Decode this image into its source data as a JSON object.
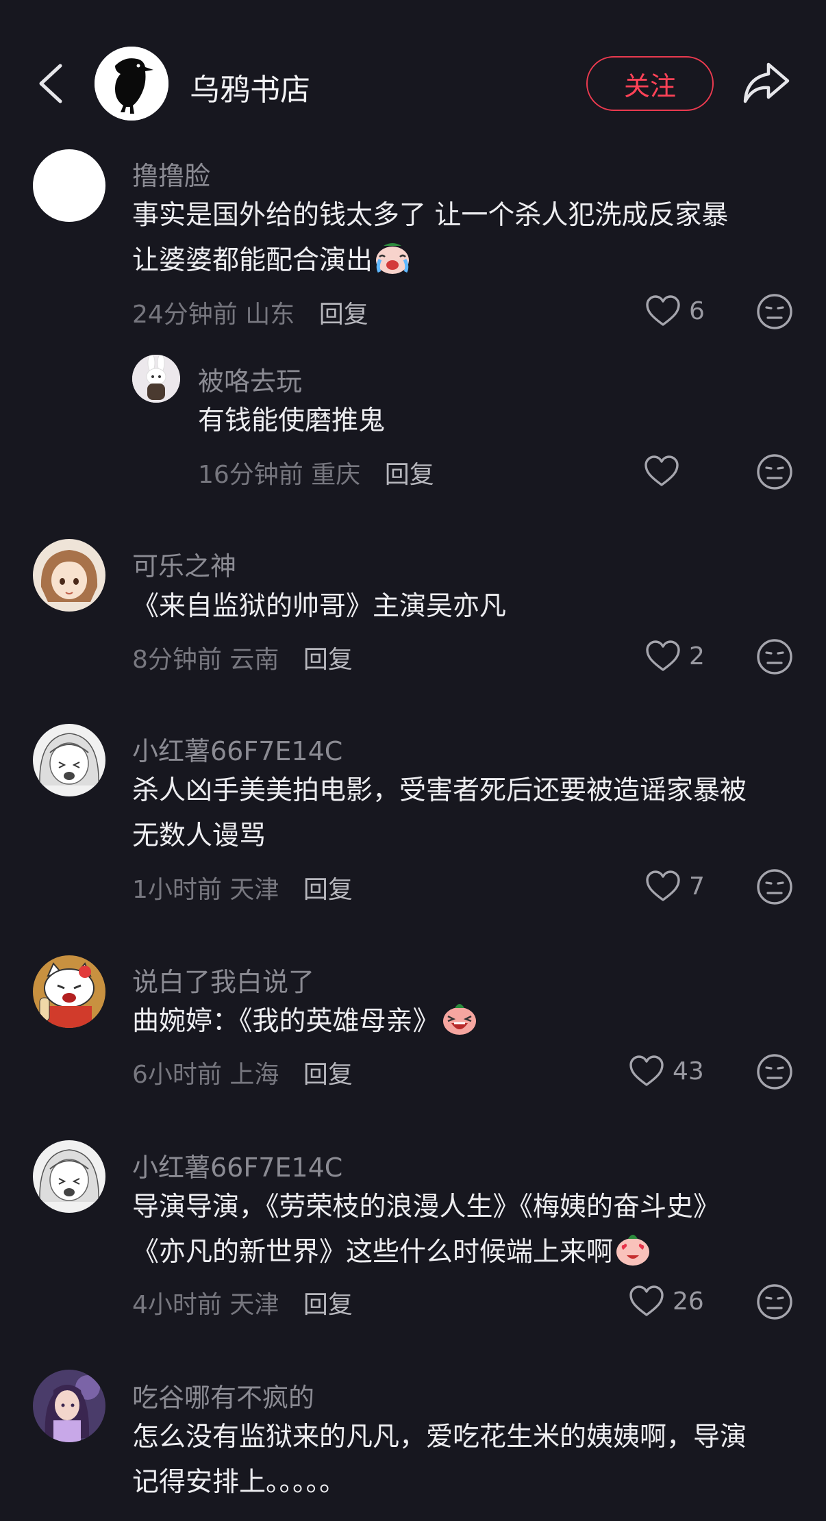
{
  "header": {
    "channel_name": "乌鸦书店",
    "follow_label": "关注"
  },
  "comments": [
    {
      "username": "撸撸脸",
      "text_lines": [
        "事实是国外给的钱太多了 让一个杀人犯洗成反家暴",
        "让婆婆都能配合演出"
      ],
      "trailing_emoji": "crying-laughing-emoji",
      "time": "24分钟前",
      "location": "山东",
      "reply_label": "回复",
      "likes": "6",
      "replies": [
        {
          "username": "被咯去玩",
          "text": "有钱能使磨推鬼",
          "time": "16分钟前",
          "location": "重庆",
          "reply_label": "回复",
          "likes": ""
        }
      ]
    },
    {
      "username": "可乐之神",
      "text_lines": [
        "《来自监狱的帅哥》主演吴亦凡"
      ],
      "time": "8分钟前",
      "location": "云南",
      "reply_label": "回复",
      "likes": "2"
    },
    {
      "username": "小红薯66F7E14C",
      "text_lines": [
        "杀人凶手美美拍电影，受害者死后还要被造谣家暴被",
        "无数人谩骂"
      ],
      "time": "1小时前",
      "location": "天津",
      "reply_label": "回复",
      "likes": "7"
    },
    {
      "username": "说白了我白说了",
      "text_lines": [
        "曲婉婷：《我的英雄母亲》"
      ],
      "trailing_emoji": "laughing-emoji",
      "time": "6小时前",
      "location": "上海",
      "reply_label": "回复",
      "likes": "43"
    },
    {
      "username": "小红薯66F7E14C",
      "text_lines": [
        "导演导演，《劳荣枝的浪漫人生》《梅姨的奋斗史》",
        "《亦凡的新世界》这些什么时候端上来啊"
      ],
      "trailing_emoji": "heart-eyes-emoji",
      "time": "4小时前",
      "location": "天津",
      "reply_label": "回复",
      "likes": "26"
    },
    {
      "username": "吃谷哪有不疯的",
      "text_lines": [
        "怎么没有监狱来的凡凡，爱吃花生米的姨姨啊，导演",
        "记得安排上。。。。。"
      ]
    }
  ],
  "colors": {
    "background": "#17171f",
    "accent": "#ea3a4f",
    "username": "#8b8b93",
    "meta": "#77777f"
  }
}
